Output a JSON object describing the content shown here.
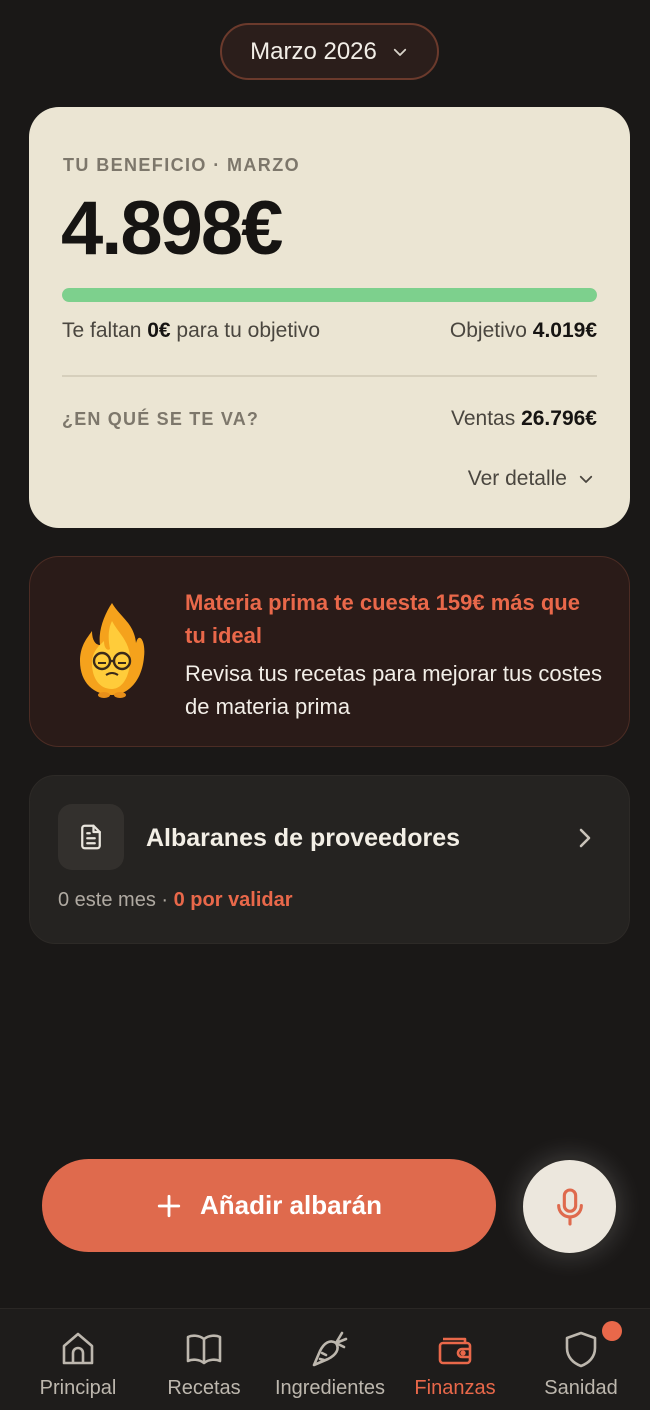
{
  "month_selector": {
    "label": "Marzo 2026"
  },
  "profit_card": {
    "label": "TU BENEFICIO · MARZO",
    "amount": "4.898€",
    "progress_fraction": 1.0,
    "remaining_prefix": "Te faltan ",
    "remaining_value": "0€",
    "remaining_suffix": " para tu objetivo",
    "goal_label": "Objetivo ",
    "goal_value": "4.019€",
    "where_label": "¿EN QUÉ SE TE VA?",
    "sales_label": "Ventas ",
    "sales_value": "26.796€",
    "detail_label": "Ver detalle"
  },
  "alert": {
    "title": "Materia prima te cuesta 159€ más que tu ideal",
    "body": "Revisa tus recetas para mejorar tus costes de materia prima"
  },
  "suppliers": {
    "title": "Albaranes de proveedores",
    "count_text": "0 este mes · ",
    "pending_text": "0 por validar"
  },
  "actions": {
    "add_label": "Añadir albarán"
  },
  "tabs": [
    {
      "label": "Principal",
      "icon": "home-icon"
    },
    {
      "label": "Recetas",
      "icon": "book-icon"
    },
    {
      "label": "Ingredientes",
      "icon": "carrot-icon"
    },
    {
      "label": "Finanzas",
      "icon": "wallet-icon",
      "active": true
    },
    {
      "label": "Sanidad",
      "icon": "shield-icon",
      "badge": true
    }
  ],
  "colors": {
    "background": "#1a1817",
    "accent": "#df6a4d",
    "card": "#ebe5d3",
    "progress": "#7dd08d"
  }
}
